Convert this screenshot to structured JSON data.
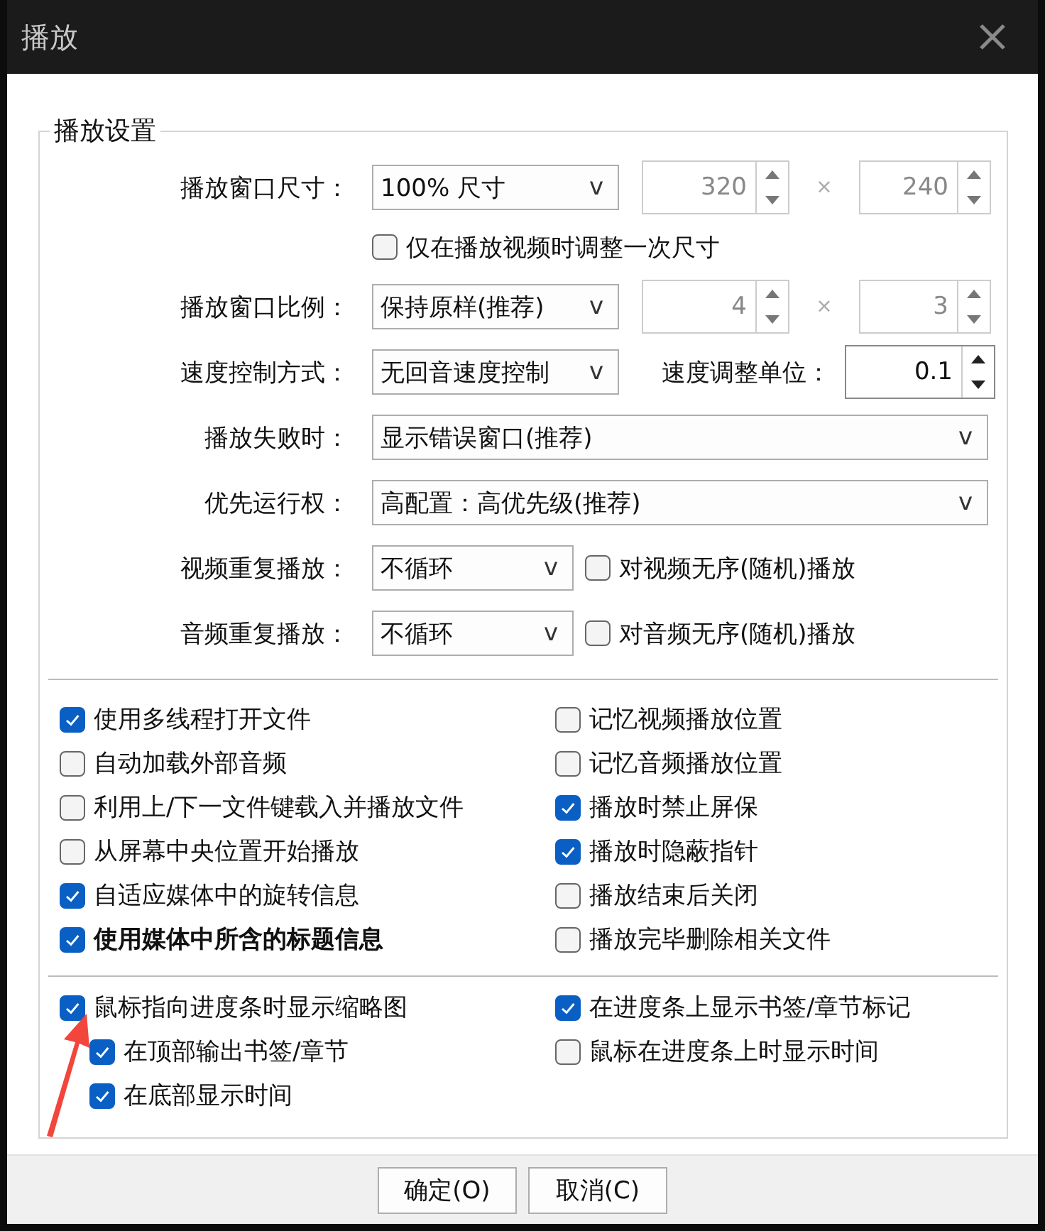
{
  "window": {
    "title": "播放"
  },
  "group": {
    "title": "播放设置",
    "rows": [
      {
        "kind": "field",
        "label": "播放窗口尺寸：",
        "combo": {
          "value": "100% 尺寸",
          "arrow": "v"
        },
        "extras": [
          {
            "kind": "spin",
            "value": "320",
            "disabled": true
          },
          {
            "kind": "times",
            "text": "×"
          },
          {
            "kind": "spin",
            "value": "240",
            "disabled": true
          }
        ]
      },
      {
        "kind": "checkbox",
        "label": "仅在播放视频时调整一次尺寸",
        "checked": false
      },
      {
        "kind": "field",
        "label": "播放窗口比例：",
        "combo": {
          "value": "保持原样(推荐)",
          "arrow": "v"
        },
        "extras": [
          {
            "kind": "spin",
            "value": "4",
            "disabled": true
          },
          {
            "kind": "times",
            "text": "×"
          },
          {
            "kind": "spin",
            "value": "3",
            "disabled": true
          }
        ]
      },
      {
        "kind": "field",
        "label": "速度控制方式：",
        "combo": {
          "value": "无回音速度控制",
          "arrow": "v"
        },
        "extras": [
          {
            "kind": "label",
            "text": "速度调整单位："
          },
          {
            "kind": "spin",
            "value": "0.1",
            "disabled": false
          }
        ]
      },
      {
        "kind": "field",
        "label": "播放失败时：",
        "combo": {
          "value": "显示错误窗口(推荐)",
          "arrow": "v"
        }
      },
      {
        "kind": "field",
        "label": "优先运行权：",
        "combo": {
          "value": "高配置：高优先级(推荐)",
          "arrow": "v"
        }
      },
      {
        "kind": "field",
        "label": "视频重复播放：",
        "combo": {
          "value": "不循环",
          "arrow": "v"
        },
        "extras": [
          {
            "kind": "checkbox",
            "label": "对视频无序(随机)播放",
            "checked": false
          }
        ]
      },
      {
        "kind": "field",
        "label": "音频重复播放：",
        "combo": {
          "value": "不循环",
          "arrow": "v"
        },
        "extras": [
          {
            "kind": "checkbox",
            "label": "对音频无序(随机)播放",
            "checked": false
          }
        ]
      }
    ],
    "options": [
      [
        {
          "label": "使用多线程打开文件",
          "checked": true,
          "bold": false
        },
        {
          "label": "自动加载外部音频",
          "checked": false,
          "bold": false
        },
        {
          "label": "利用上/下一文件键载入并播放文件",
          "checked": false,
          "bold": false
        },
        {
          "label": "从屏幕中央位置开始播放",
          "checked": false,
          "bold": false
        },
        {
          "label": "自适应媒体中的旋转信息",
          "checked": true,
          "bold": false
        },
        {
          "label": "使用媒体中所含的标题信息",
          "checked": true,
          "bold": true
        }
      ],
      [
        {
          "label": "记忆视频播放位置",
          "checked": false,
          "bold": false
        },
        {
          "label": "记忆音频播放位置",
          "checked": false,
          "bold": false
        },
        {
          "label": "播放时禁止屏保",
          "checked": true,
          "bold": false
        },
        {
          "label": "播放时隐蔽指针",
          "checked": true,
          "bold": false
        },
        {
          "label": "播放结束后关闭",
          "checked": false,
          "bold": false
        },
        {
          "label": "播放完毕删除相关文件",
          "checked": false,
          "bold": false
        }
      ]
    ],
    "seek_options": [
      [
        {
          "label": "鼠标指向进度条时显示缩略图",
          "checked": true,
          "children": [
            {
              "label": "在顶部输出书签/章节",
              "checked": true
            },
            {
              "label": "在底部显示时间",
              "checked": true
            }
          ]
        }
      ],
      [
        {
          "label": "在进度条上显示书签/章节标记",
          "checked": true
        },
        {
          "label": "鼠标在进度条上时显示时间",
          "checked": false
        }
      ]
    ]
  },
  "buttons": [
    "确定(O)",
    "取消(C)"
  ]
}
